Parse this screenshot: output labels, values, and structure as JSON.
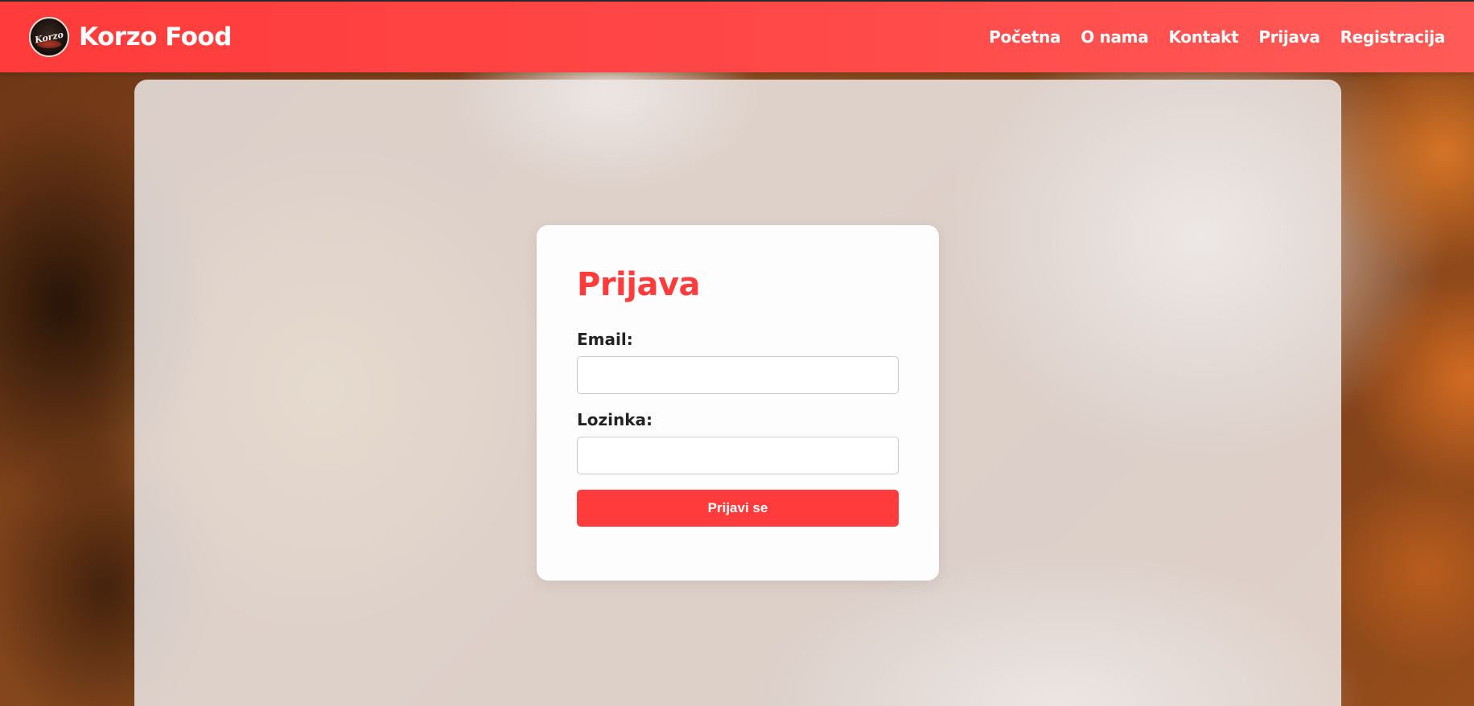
{
  "brand": {
    "logo_text": "Korzo",
    "name": "Korzo Food"
  },
  "nav": {
    "items": [
      {
        "label": "Početna"
      },
      {
        "label": "O nama"
      },
      {
        "label": "Kontakt"
      },
      {
        "label": "Prijava"
      },
      {
        "label": "Registracija"
      }
    ]
  },
  "login": {
    "title": "Prijava",
    "email_label": "Email:",
    "email_value": "",
    "email_placeholder": "",
    "password_label": "Lozinka:",
    "password_value": "",
    "password_placeholder": "",
    "submit_label": "Prijavi se"
  },
  "colors": {
    "accent": "#ff3b3b",
    "navbar": "#ff4747",
    "text": "#222222"
  },
  "icons": {
    "logo": "korzo-food-logo-icon"
  }
}
